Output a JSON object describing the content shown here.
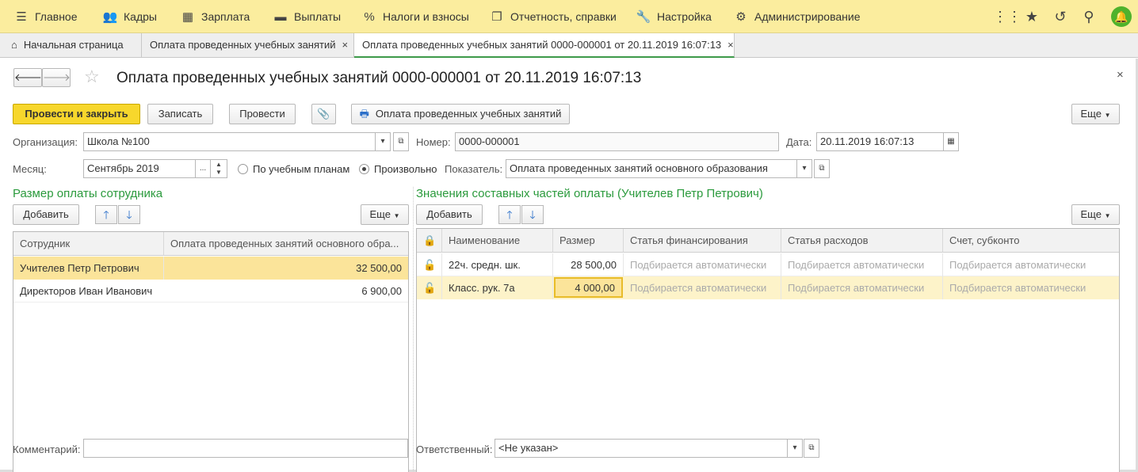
{
  "menubar": {
    "items": [
      {
        "label": "Главное",
        "icon": "hamburger-icon"
      },
      {
        "label": "Кадры",
        "icon": "people-icon"
      },
      {
        "label": "Зарплата",
        "icon": "calculator-icon"
      },
      {
        "label": "Выплаты",
        "icon": "wallet-icon"
      },
      {
        "label": "Налоги и взносы",
        "icon": "percent-icon"
      },
      {
        "label": "Отчетность, справки",
        "icon": "documents-icon"
      },
      {
        "label": "Настройка",
        "icon": "wrench-icon"
      },
      {
        "label": "Администрирование",
        "icon": "gear-icon"
      }
    ]
  },
  "tabs": [
    {
      "label": "Начальная страница",
      "icon": "home-icon"
    },
    {
      "label": "Оплата проведенных учебных занятий",
      "close": "×"
    },
    {
      "label": "Оплата проведенных учебных занятий 0000-000001 от 20.11.2019 16:07:13",
      "close": "×"
    }
  ],
  "form": {
    "title": "Оплата проведенных учебных занятий 0000-000001 от 20.11.2019 16:07:13",
    "close": "×",
    "toolbar": {
      "post_close": "Провести и закрыть",
      "save": "Записать",
      "post": "Провести",
      "print": "Оплата проведенных учебных занятий",
      "more": "Еще"
    },
    "org_label": "Организация:",
    "org_value": "Школа №100",
    "number_label": "Номер:",
    "number_value": "0000-000001",
    "date_label": "Дата:",
    "date_value": "20.11.2019 16:07:13",
    "month_label": "Месяц:",
    "month_value": "Сентябрь 2019",
    "month_dots": "...",
    "radio_plans": "По учебным планам",
    "radio_free": "Произвольно",
    "indicator_label": "Показатель:",
    "indicator_value": "Оплата проведенных занятий основного образования",
    "comment_label": "Комментарий:",
    "comment_value": "",
    "responsible_label": "Ответственный:",
    "responsible_value": "<Не указан>"
  },
  "left_panel": {
    "title": "Размер оплаты сотрудника",
    "add": "Добавить",
    "more": "Еще",
    "columns": [
      "Сотрудник",
      "Оплата проведенных занятий основного обра..."
    ],
    "rows": [
      {
        "employee": "Учителев Петр Петрович",
        "amount": "32 500,00"
      },
      {
        "employee": "Директоров Иван Иванович",
        "amount": "6 900,00"
      }
    ]
  },
  "right_panel": {
    "title": "Значения составных частей оплаты (Учителев Петр Петрович)",
    "add": "Добавить",
    "more": "Еще",
    "columns": [
      "Наименование",
      "Размер",
      "Статья финансирования",
      "Статья расходов",
      "Счет, субконто"
    ],
    "rows": [
      {
        "name": "22ч. средн. шк.",
        "size": "28 500,00",
        "fin": "Подбирается автоматически",
        "exp": "Подбирается автоматически",
        "acc": "Подбирается автоматически"
      },
      {
        "name": "Класс. рук. 7а",
        "size": "4 000,00",
        "fin": "Подбирается автоматически",
        "exp": "Подбирается автоматически",
        "acc": "Подбирается автоматически"
      }
    ]
  },
  "colors": {
    "accent_yellow": "#f7d72c",
    "menubar": "#fbed9e",
    "section_green": "#2a9a3c",
    "selected_row": "#fbe49a"
  }
}
